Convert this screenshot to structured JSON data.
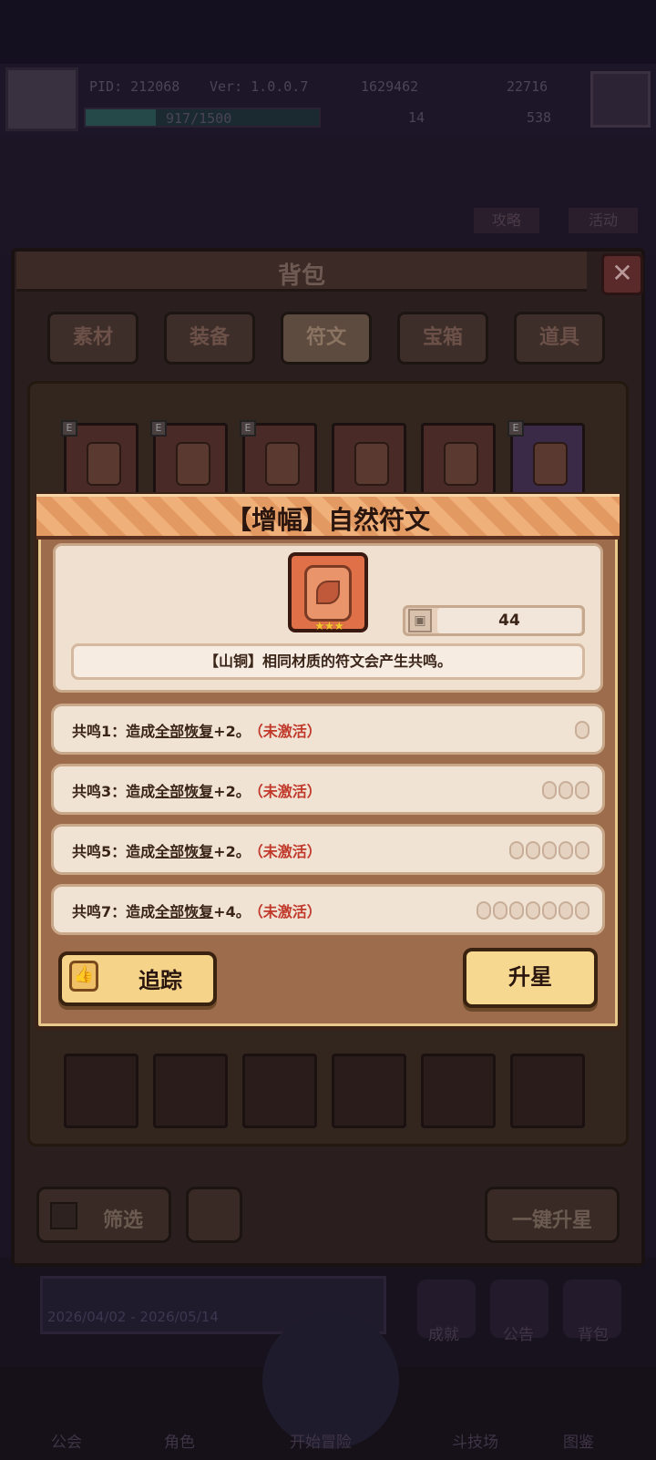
{
  "hud": {
    "pid": "PID: 212068",
    "version": "Ver: 1.0.0.7",
    "gold": "1629462",
    "gems": "22716",
    "exp": "917/1500",
    "clover": "14",
    "keys": "538"
  },
  "background": {
    "labels": [
      "攻略",
      "活动"
    ],
    "banner_date": "2026/04/02 - 2026/05/14",
    "side_labels": [
      "成就",
      "公告",
      "背包"
    ],
    "nav": [
      "公会",
      "角色",
      "开始冒险",
      "斗技场",
      "图鉴"
    ]
  },
  "bag": {
    "title": "背包",
    "close_label": "✕",
    "tabs": [
      "素材",
      "装备",
      "符文",
      "宝箱",
      "道具"
    ],
    "active_tab": "符文",
    "filter_label": "筛选",
    "one_key_star_label": "一键升星"
  },
  "rune_detail": {
    "title": "【增幅】自然符文",
    "stars": "★★★",
    "count": "44",
    "description": "【山铜】相同材质的符文会产生共鸣。",
    "resonances": [
      {
        "prefix": "共鸣1：造成",
        "keyword": "全部恢复",
        "suffix": "+2。",
        "status": "（未激活）",
        "dots": 1
      },
      {
        "prefix": "共鸣3：造成",
        "keyword": "全部恢复",
        "suffix": "+2。",
        "status": "（未激活）",
        "dots": 3
      },
      {
        "prefix": "共鸣5：造成",
        "keyword": "全部恢复",
        "suffix": "+2。",
        "status": "（未激活）",
        "dots": 5
      },
      {
        "prefix": "共鸣7：造成",
        "keyword": "全部恢复",
        "suffix": "+4。",
        "status": "（未激活）",
        "dots": 7
      }
    ],
    "track_label": "追踪",
    "upgrade_label": "升星"
  },
  "colors": {
    "inactive": "#c0392b",
    "button": "#f6d890",
    "header": "#e39a62"
  }
}
